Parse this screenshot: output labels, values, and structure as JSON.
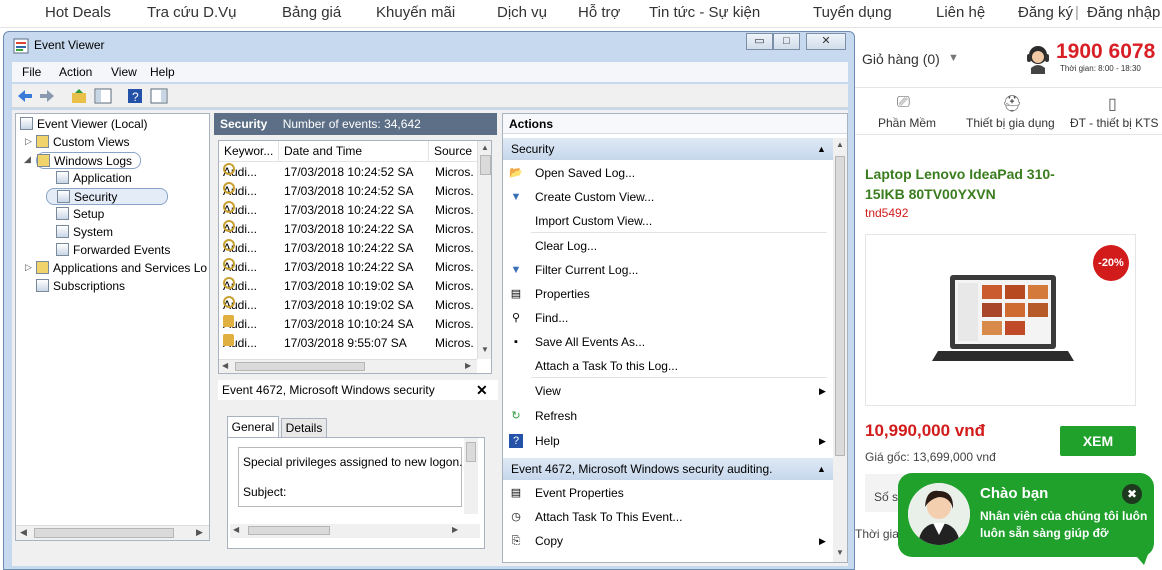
{
  "site": {
    "nav": [
      "Hot Deals",
      "Tra cứu D.Vụ",
      "Bảng giá",
      "Khuyến mãi",
      "Dịch vụ",
      "Hỗ trợ",
      "Tin tức - Sự kiện",
      "Tuyển dụng",
      "Liên hệ",
      "Đăng ký",
      "|",
      "Đăng nhập"
    ],
    "cart": "Giỏ hàng (0)",
    "hotline": "1900 6078",
    "hotline_time": "Thời gian: 8:00 - 18:30",
    "categories": [
      "Phần Mềm",
      "Thiết bị gia dụng",
      "ĐT - thiết bị KTS"
    ],
    "product": {
      "name": "Laptop Lenovo IdeaPad 310-15IKB 80TV00YXVN",
      "code": "tnd5492",
      "discount": "-20%",
      "price": "10,990,000 vnđ",
      "view_button": "XEM",
      "original_price": "Giá gốc: 13,699,000 vnđ",
      "left_labels": [
        "Số s",
        "Thời gia"
      ]
    },
    "chat": {
      "title": "Chào bạn",
      "message": "Nhân viên của chúng tôi luôn luôn sẵn sàng giúp đỡ"
    }
  },
  "window": {
    "title": "Event Viewer",
    "buttons": [
      "▭",
      "□",
      "✕"
    ],
    "menu": [
      "File",
      "Action",
      "View",
      "Help"
    ]
  },
  "tree": {
    "root": "Event Viewer (Local)",
    "items": [
      "Custom Views",
      "Windows Logs",
      "Application",
      "Security",
      "Setup",
      "System",
      "Forwarded Events",
      "Applications and Services Lo",
      "Subscriptions"
    ]
  },
  "center": {
    "title": "Security",
    "event_count": "Number of events: 34,642",
    "columns": [
      "Keywor...",
      "Date and Time",
      "Source"
    ],
    "rows": [
      {
        "keyword": "Audi...",
        "date": "17/03/2018 10:24:52 SA",
        "source": "Micros.",
        "icon": "key-icon"
      },
      {
        "keyword": "Audi...",
        "date": "17/03/2018 10:24:52 SA",
        "source": "Micros.",
        "icon": "key-icon"
      },
      {
        "keyword": "Audi...",
        "date": "17/03/2018 10:24:22 SA",
        "source": "Micros.",
        "icon": "key-icon"
      },
      {
        "keyword": "Audi...",
        "date": "17/03/2018 10:24:22 SA",
        "source": "Micros.",
        "icon": "key-icon"
      },
      {
        "keyword": "Audi...",
        "date": "17/03/2018 10:24:22 SA",
        "source": "Micros.",
        "icon": "key-icon"
      },
      {
        "keyword": "Audi...",
        "date": "17/03/2018 10:24:22 SA",
        "source": "Micros.",
        "icon": "key-icon"
      },
      {
        "keyword": "Audi...",
        "date": "17/03/2018 10:19:02 SA",
        "source": "Micros.",
        "icon": "key-icon"
      },
      {
        "keyword": "Audi...",
        "date": "17/03/2018 10:19:02 SA",
        "source": "Micros.",
        "icon": "key-icon"
      },
      {
        "keyword": "Audi...",
        "date": "17/03/2018 10:10:24 SA",
        "source": "Micros.",
        "icon": "lock-icon"
      },
      {
        "keyword": "Audi...",
        "date": "17/03/2018 9:55:07 SA",
        "source": "Micros.",
        "icon": "lock-icon"
      }
    ],
    "details_title": "Event 4672, Microsoft Windows security",
    "details_tabs": [
      "General",
      "Details"
    ],
    "details_text": "Special privileges assigned to new logon.",
    "details_text2": "Subject:"
  },
  "actions": {
    "header": "Actions",
    "section1": "Security",
    "items1": [
      "Open Saved Log...",
      "Create Custom View...",
      "Import Custom View...",
      "Clear Log...",
      "Filter Current Log...",
      "Properties",
      "Find...",
      "Save All Events As...",
      "Attach a Task To this Log...",
      "View",
      "Refresh",
      "Help"
    ],
    "section2": "Event 4672, Microsoft Windows security auditing.",
    "items2": [
      "Event Properties",
      "Attach Task To This Event...",
      "Copy"
    ]
  },
  "colors": {
    "accent_green": "#1fa12c",
    "price_red": "#d21b1b",
    "hotline_red": "#d81f26",
    "header_blue": "#5c6f86"
  }
}
